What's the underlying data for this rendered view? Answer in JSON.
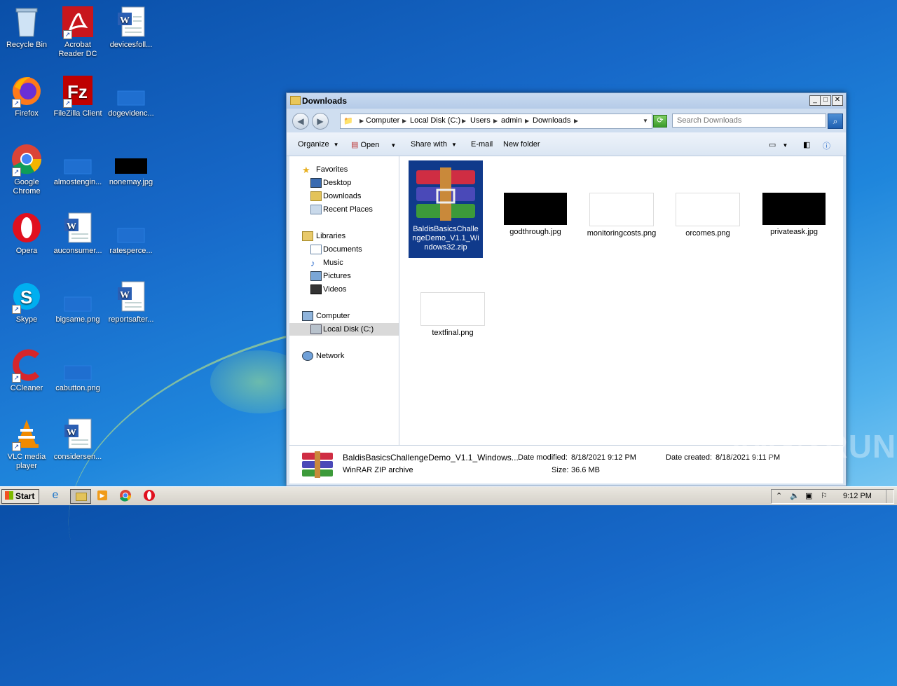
{
  "desktop": {
    "icons": [
      {
        "label": "Recycle Bin",
        "icon": "recycle-bin-icon"
      },
      {
        "label": "Acrobat Reader DC",
        "icon": "acrobat-icon"
      },
      {
        "label": "devicesfoll...",
        "icon": "word-doc-icon"
      },
      {
        "label": "Firefox",
        "icon": "firefox-icon"
      },
      {
        "label": "FileZilla Client",
        "icon": "filezilla-icon"
      },
      {
        "label": "dogevidenc...",
        "icon": "blank-file-icon"
      },
      {
        "label": "Google Chrome",
        "icon": "chrome-icon"
      },
      {
        "label": "almostengin...",
        "icon": "blank-file-icon"
      },
      {
        "label": "nonemay.jpg",
        "icon": "black-image-icon"
      },
      {
        "label": "Opera",
        "icon": "opera-icon"
      },
      {
        "label": "auconsumer...",
        "icon": "word-doc-icon"
      },
      {
        "label": "ratesperce...",
        "icon": "blank-file-icon"
      },
      {
        "label": "Skype",
        "icon": "skype-icon"
      },
      {
        "label": "bigsame.png",
        "icon": "blank-file-icon"
      },
      {
        "label": "reportsafter...",
        "icon": "word-doc-icon"
      },
      {
        "label": "CCleaner",
        "icon": "ccleaner-icon"
      },
      {
        "label": "cabutton.png",
        "icon": "blank-file-icon"
      },
      {
        "label": "VLC media player",
        "icon": "vlc-icon"
      },
      {
        "label": "considersen...",
        "icon": "word-doc-icon"
      }
    ]
  },
  "window": {
    "title": "Downloads",
    "buttons": {
      "minimize": "_",
      "maximize": "□",
      "close": "✕"
    },
    "breadcrumb": [
      "Computer",
      "Local Disk (C:)",
      "Users",
      "admin",
      "Downloads"
    ],
    "search_placeholder": "Search Downloads",
    "toolbar": {
      "organize": "Organize",
      "open": "Open",
      "share_with": "Share with",
      "email": "E-mail",
      "new_folder": "New folder"
    },
    "nav": {
      "favorites": "Favorites",
      "desktop": "Desktop",
      "downloads": "Downloads",
      "recent_places": "Recent Places",
      "libraries": "Libraries",
      "documents": "Documents",
      "music": "Music",
      "pictures": "Pictures",
      "videos": "Videos",
      "computer": "Computer",
      "local_disk": "Local Disk (C:)",
      "network": "Network"
    },
    "files": [
      {
        "name": "BaldisBasicsChallengeDemo_V1.1_Windows32.zip",
        "type": "winrar",
        "selected": true
      },
      {
        "name": "godthrough.jpg",
        "type": "black"
      },
      {
        "name": "monitoringcosts.png",
        "type": "white"
      },
      {
        "name": "orcomes.png",
        "type": "white"
      },
      {
        "name": "privateask.jpg",
        "type": "black"
      },
      {
        "name": "textfinal.png",
        "type": "white"
      }
    ],
    "details": {
      "name": "BaldisBasicsChallengeDemo_V1.1_Windows...",
      "kind": "WinRAR ZIP archive",
      "modified_label": "Date modified:",
      "modified_value": "8/18/2021 9:12 PM",
      "size_label": "Size:",
      "size_value": "36.6 MB",
      "created_label": "Date created:",
      "created_value": "8/18/2021 9:11 PM"
    }
  },
  "taskbar": {
    "start": "Start",
    "clock": "9:12 PM"
  },
  "watermark": "ANY▷RUN"
}
